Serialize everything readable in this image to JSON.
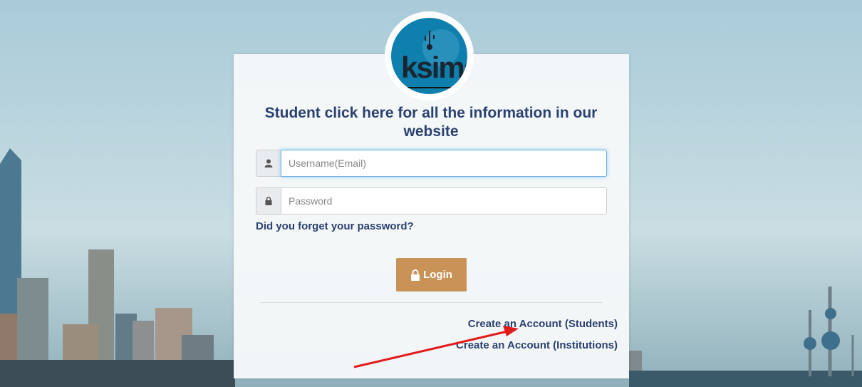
{
  "logo": {
    "text": "ksims",
    "icon": "usb-icon"
  },
  "headline": "Student click here for all the information in our website",
  "form": {
    "username_placeholder": "Username(Email)",
    "password_placeholder": "Password",
    "forgot_label": "Did you forget your password?",
    "login_label": "Login"
  },
  "links": {
    "create_students": "Create an Account (Students)",
    "create_institutions": "Create an Account (Institutions)"
  },
  "colors": {
    "heading": "#2b4170",
    "button": "#c99257",
    "annotation_arrow": "#e11b1b"
  }
}
